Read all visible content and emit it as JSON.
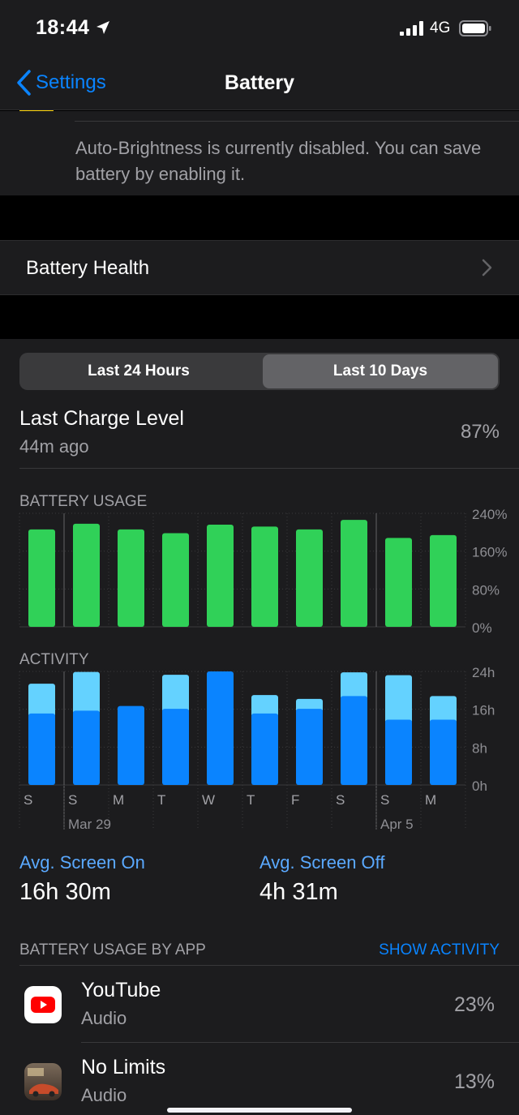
{
  "status_bar": {
    "time": "18:44",
    "network": "4G"
  },
  "nav": {
    "back_label": "Settings",
    "title": "Battery"
  },
  "auto_brightness": {
    "text": "Auto-Brightness is currently disabled. You can save battery by enabling it."
  },
  "battery_health": {
    "label": "Battery Health"
  },
  "segmented": {
    "left": "Last 24 Hours",
    "right": "Last 10 Days",
    "selected": "Last 10 Days"
  },
  "last_charge": {
    "title": "Last Charge Level",
    "ago": "44m ago",
    "value": "87%"
  },
  "sections": {
    "usage": "BATTERY USAGE",
    "activity": "ACTIVITY"
  },
  "chart_data": [
    {
      "type": "bar",
      "title": "BATTERY USAGE",
      "categories": [
        "S",
        "S",
        "M",
        "T",
        "W",
        "T",
        "F",
        "S",
        "S",
        "M"
      ],
      "values": [
        206,
        218,
        206,
        198,
        216,
        212,
        206,
        226,
        188,
        194
      ],
      "y_unit": "%",
      "ylim": [
        0,
        240
      ],
      "y_ticks": [
        "240%",
        "160%",
        "80%",
        "0%"
      ],
      "color": "#30d158",
      "grid": true
    },
    {
      "type": "bar",
      "title": "ACTIVITY",
      "categories": [
        "S",
        "S",
        "M",
        "T",
        "W",
        "T",
        "F",
        "S",
        "S",
        "M"
      ],
      "series": [
        {
          "name": "Screen On",
          "values": [
            15.1,
            15.7,
            16.7,
            16.1,
            24.0,
            15.1,
            16.1,
            18.8,
            13.8,
            13.8
          ],
          "color": "#0a84ff"
        },
        {
          "name": "Screen Off",
          "values": [
            6.3,
            8.2,
            0,
            7.2,
            0,
            3.9,
            2.1,
            5.0,
            9.4,
            5.0
          ],
          "color": "#64d2ff"
        }
      ],
      "stacked": true,
      "ylim": [
        0,
        24
      ],
      "y_ticks": [
        "24h",
        "16h",
        "8h",
        "0h"
      ],
      "date_labels": [
        {
          "index": 1,
          "label": "Mar 29"
        },
        {
          "index": 8,
          "label": "Apr 5"
        }
      ],
      "grid": true
    }
  ],
  "averages": {
    "screen_on_label": "Avg. Screen On",
    "screen_on_value": "16h 30m",
    "screen_off_label": "Avg. Screen Off",
    "screen_off_value": "4h 31m"
  },
  "by_app": {
    "label": "BATTERY USAGE BY APP",
    "action": "SHOW ACTIVITY"
  },
  "apps": [
    {
      "name": "YouTube",
      "sub": "Audio",
      "pct": "23%",
      "icon": "youtube-icon"
    },
    {
      "name": "No Limits",
      "sub": "Audio",
      "pct": "13%",
      "icon": "need-for-speed-icon"
    }
  ],
  "colors": {
    "accent": "#0a84ff",
    "green": "#30d158",
    "light_blue": "#64d2ff"
  }
}
